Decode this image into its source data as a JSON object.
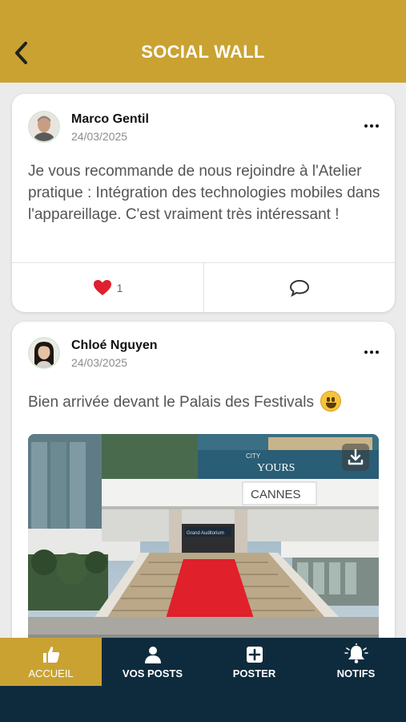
{
  "header": {
    "title": "SOCIAL WALL"
  },
  "posts": [
    {
      "author": "Marco Gentil",
      "date": "24/03/2025",
      "text": "Je vous recommande de nous rejoindre à l'Atelier pratique : Intégration des technologies mobiles dans l'appareillage. C'est vraiment très intéressant !",
      "likes": "1"
    },
    {
      "author": "Chloé Nguyen",
      "date": "24/03/2025",
      "text": "Bien arrivée devant le Palais des Festivals",
      "image_texts": {
        "city": "CITY",
        "yours": "YOURS",
        "cannes": "CANNES",
        "auditorium": "Grand Auditorium"
      }
    }
  ],
  "tabbar": {
    "tabs": [
      {
        "label": "ACCUEIL",
        "icon": "thumbs-up-icon",
        "active": true
      },
      {
        "label": "VOS POSTS",
        "icon": "user-icon",
        "active": false
      },
      {
        "label": "POSTER",
        "icon": "plus-square-icon",
        "active": false
      },
      {
        "label": "NOTIFS",
        "icon": "bell-icon",
        "active": false
      }
    ]
  },
  "colors": {
    "accent": "#c9a232",
    "tabbar": "#0e2b3d",
    "like": "#e0202e"
  }
}
